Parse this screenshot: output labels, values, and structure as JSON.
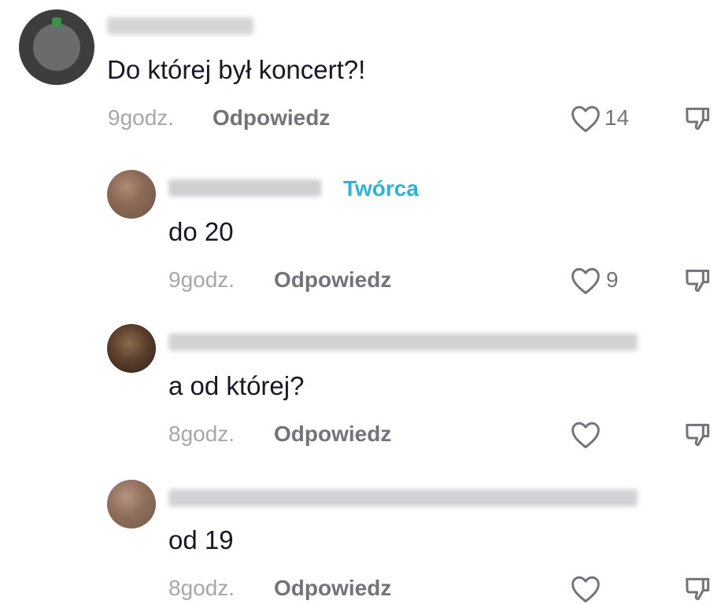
{
  "colors": {
    "text": "#161823",
    "meta": "#a7a7ab",
    "reply": "#737479",
    "creator_badge": "#2fb3d4"
  },
  "comments": [
    {
      "text": "Do której był koncert?!",
      "time": "9godz.",
      "reply_label": "Odpowiedz",
      "likes": "14",
      "is_reply": false
    },
    {
      "text": "do 20",
      "time": "9godz.",
      "reply_label": "Odpowiedz",
      "likes": "9",
      "badge": "Twórca",
      "is_reply": true
    },
    {
      "text": "a od której?",
      "time": "8godz.",
      "reply_label": "Odpowiedz",
      "likes": "",
      "is_reply": true
    },
    {
      "text": "od 19",
      "time": "8godz.",
      "reply_label": "Odpowiedz",
      "likes": "",
      "is_reply": true
    }
  ],
  "icons": {
    "like": "heart-outline-icon",
    "dislike": "thumbs-down-icon"
  }
}
